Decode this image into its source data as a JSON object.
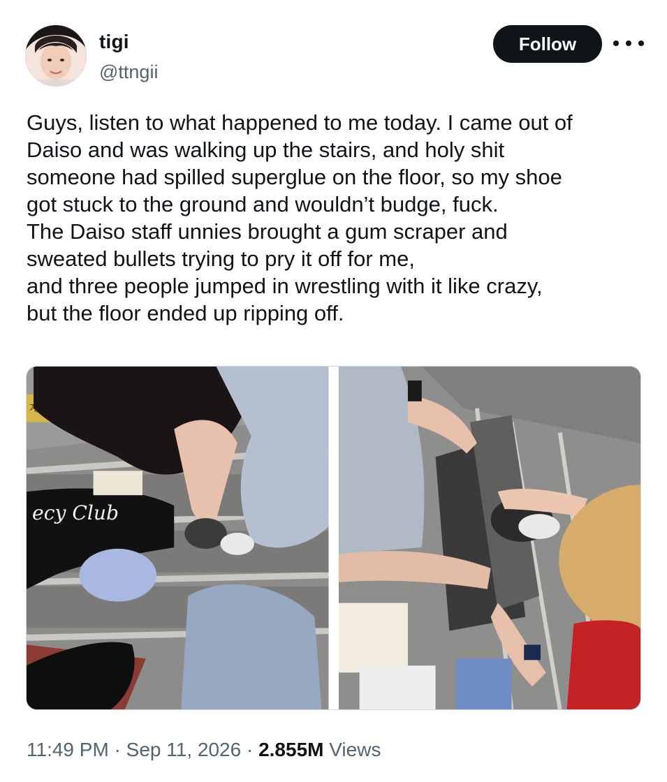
{
  "author": {
    "name": "tigi",
    "handle": "@ttngii"
  },
  "actions": {
    "follow_label": "Follow",
    "more_icon": "more-horizontal-icon"
  },
  "tweet": {
    "lines": [
      "Guys, listen to what happened to me today. I came out of",
      "Daiso and was walking up the stairs, and holy shit",
      "someone had spilled superglue on the floor, so my shoe",
      "got stuck to the ground and wouldn’t budge, fuck.",
      "The Daiso staff unnies brought a gum scraper and",
      "sweated bullets trying to pry it off for me,",
      "and three people jumped in wrestling with it like crazy,",
      "but the floor ended up ripping off."
    ]
  },
  "media": {
    "left_photo_sign_text": "계단안내",
    "left_photo_shirt_text": "ecy Club"
  },
  "meta": {
    "time": "11:49 PM",
    "separator": "·",
    "date": "Sep 11, 2026",
    "views_count": "2.855M",
    "views_label": "Views"
  },
  "colors": {
    "text": "#0f1419",
    "secondary": "#536471",
    "button_bg": "#0f1419",
    "button_text": "#ffffff",
    "border": "#cfd9de"
  }
}
